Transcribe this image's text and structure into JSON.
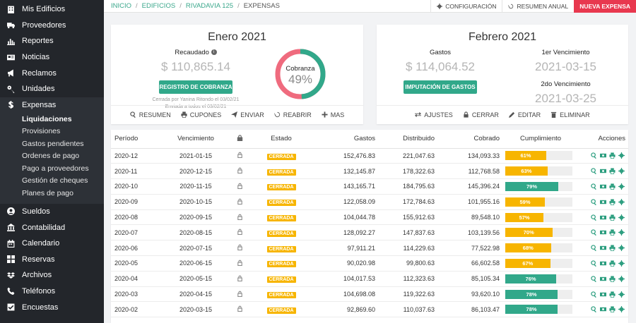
{
  "sidebar": {
    "items_top": [
      {
        "label": "Mis Edificios",
        "icon": "building-icon"
      },
      {
        "label": "Proveedores",
        "icon": "truck-icon"
      },
      {
        "label": "Reportes",
        "icon": "bar-chart-icon"
      },
      {
        "label": "Noticias",
        "icon": "newspaper-icon"
      },
      {
        "label": "Reclamos",
        "icon": "megaphone-icon"
      },
      {
        "label": "Unidades",
        "icon": "key-icon"
      },
      {
        "label": "Expensas",
        "icon": "dollar-icon"
      }
    ],
    "subitems": [
      "Liquidaciones",
      "Provisiones",
      "Gastos pendientes",
      "Ordenes de pago",
      "Pago a proveedores",
      "Gestión de cheques",
      "Planes de pago"
    ],
    "items_bottom": [
      {
        "label": "Sueldos",
        "icon": "user-circle-icon"
      },
      {
        "label": "Contabilidad",
        "icon": "bank-icon"
      },
      {
        "label": "Calendario",
        "icon": "calendar-icon"
      },
      {
        "label": "Reservas",
        "icon": "grid-icon"
      },
      {
        "label": "Archivos",
        "icon": "dropbox-icon"
      },
      {
        "label": "Teléfonos",
        "icon": "phone-icon"
      },
      {
        "label": "Encuestas",
        "icon": "checkbox-icon"
      }
    ]
  },
  "breadcrumb": {
    "items": [
      "INICIO",
      "EDIFICIOS",
      "RIVADAVIA 125"
    ],
    "current": "EXPENSAS"
  },
  "top_actions": {
    "config": "CONFIGURACIÓN",
    "resumen_anual": "RESUMEN ANUAL",
    "nueva": "NUEVA EXPENSA"
  },
  "card1": {
    "title": "Enero 2021",
    "recaudado_label": "Recaudado",
    "recaudado_value": "$ 110,865.14",
    "button": "REGISTRO DE COBRANZA",
    "note1": "Cerrada por Yanina Ritondo el 03/02/21",
    "note2": "Enviada a todos el 03/02/21",
    "donut_label": "Cobranza",
    "donut_value": "49%",
    "donut_fraction": 0.49,
    "actions": [
      "RESUMEN",
      "CUPONES",
      "ENVIAR",
      "REABRIR",
      "MAS"
    ]
  },
  "card2": {
    "title": "Febrero 2021",
    "gastos_label": "Gastos",
    "gastos_value": "$ 114,064.52",
    "button": "IMPUTACIÓN DE GASTOS",
    "venc1_label": "1er Vencimiento",
    "venc1_value": "2021-03-15",
    "venc2_label": "2do Vencimiento",
    "venc2_value": "2021-03-25",
    "actions": [
      "AJUSTES",
      "CERRAR",
      "EDITAR",
      "ELIMINAR"
    ]
  },
  "table": {
    "headers": [
      "Período",
      "Vencimiento",
      "",
      "Estado",
      "Gastos",
      "Distribuido",
      "Cobrado",
      "Cumplimiento",
      "Acciones"
    ],
    "rows": [
      {
        "periodo": "2020-12",
        "venc": "2021-01-15",
        "estado": "CERRADA",
        "gastos": "152,476.83",
        "dist": "221,047.63",
        "cobrado": "134,093.33",
        "cumpl": "61%",
        "pct": 61
      },
      {
        "periodo": "2020-11",
        "venc": "2020-12-15",
        "estado": "CERRADA",
        "gastos": "132,145.87",
        "dist": "178,322.63",
        "cobrado": "112,768.58",
        "cumpl": "63%",
        "pct": 63
      },
      {
        "periodo": "2020-10",
        "venc": "2020-11-15",
        "estado": "CERRADA",
        "gastos": "143,165.71",
        "dist": "184,795.63",
        "cobrado": "145,396.24",
        "cumpl": "79%",
        "pct": 79
      },
      {
        "periodo": "2020-09",
        "venc": "2020-10-15",
        "estado": "CERRADA",
        "gastos": "122,058.09",
        "dist": "172,784.63",
        "cobrado": "101,955.16",
        "cumpl": "59%",
        "pct": 59
      },
      {
        "periodo": "2020-08",
        "venc": "2020-09-15",
        "estado": "CERRADA",
        "gastos": "104,044.78",
        "dist": "155,912.63",
        "cobrado": "89,548.10",
        "cumpl": "57%",
        "pct": 57
      },
      {
        "periodo": "2020-07",
        "venc": "2020-08-15",
        "estado": "CERRADA",
        "gastos": "128,092.27",
        "dist": "147,837.63",
        "cobrado": "103,139.56",
        "cumpl": "70%",
        "pct": 70
      },
      {
        "periodo": "2020-06",
        "venc": "2020-07-15",
        "estado": "CERRADA",
        "gastos": "97,911.21",
        "dist": "114,229.63",
        "cobrado": "77,522.98",
        "cumpl": "68%",
        "pct": 68
      },
      {
        "periodo": "2020-05",
        "venc": "2020-06-15",
        "estado": "CERRADA",
        "gastos": "90,020.98",
        "dist": "99,800.63",
        "cobrado": "66,602.58",
        "cumpl": "67%",
        "pct": 67
      },
      {
        "periodo": "2020-04",
        "venc": "2020-05-15",
        "estado": "CERRADA",
        "gastos": "104,017.53",
        "dist": "112,323.63",
        "cobrado": "85,105.34",
        "cumpl": "76%",
        "pct": 76
      },
      {
        "periodo": "2020-03",
        "venc": "2020-04-15",
        "estado": "CERRADA",
        "gastos": "104,698.08",
        "dist": "119,322.63",
        "cobrado": "93,620.10",
        "cumpl": "78%",
        "pct": 78
      },
      {
        "periodo": "2020-02",
        "venc": "2020-03-15",
        "estado": "CERRADA",
        "gastos": "92,869.60",
        "dist": "110,037.63",
        "cobrado": "86,103.47",
        "cumpl": "78%",
        "pct": 78
      }
    ]
  },
  "colors": {
    "green": "#31a88a",
    "yellow": "#f7b500",
    "red": "#e8384f",
    "sidebar": "#23262b",
    "donut_red": "#ef6b7e"
  }
}
